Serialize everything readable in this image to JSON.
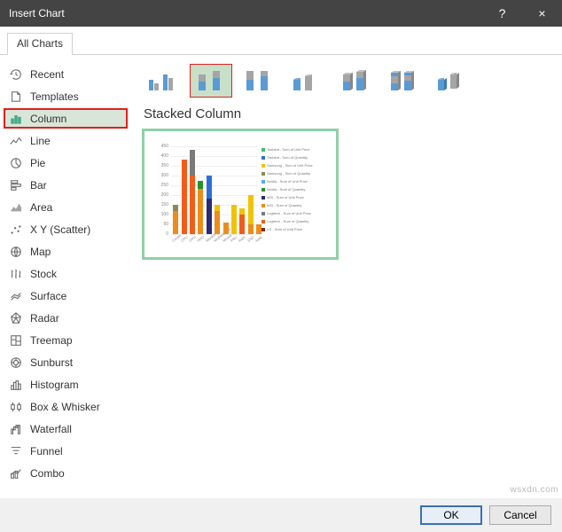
{
  "window": {
    "title": "Insert Chart",
    "help_label": "?",
    "close_label": "×"
  },
  "tabs": {
    "all_charts": "All Charts"
  },
  "sidebar": {
    "items": [
      {
        "label": "Recent"
      },
      {
        "label": "Templates"
      },
      {
        "label": "Column"
      },
      {
        "label": "Line"
      },
      {
        "label": "Pie"
      },
      {
        "label": "Bar"
      },
      {
        "label": "Area"
      },
      {
        "label": "X Y (Scatter)"
      },
      {
        "label": "Map"
      },
      {
        "label": "Stock"
      },
      {
        "label": "Surface"
      },
      {
        "label": "Radar"
      },
      {
        "label": "Treemap"
      },
      {
        "label": "Sunburst"
      },
      {
        "label": "Histogram"
      },
      {
        "label": "Box & Whisker"
      },
      {
        "label": "Waterfall"
      },
      {
        "label": "Funnel"
      },
      {
        "label": "Combo"
      }
    ],
    "selected_index": 2
  },
  "subtype": {
    "selected_index": 1,
    "title": "Stacked Column",
    "names": [
      "Clustered Column",
      "Stacked Column",
      "100% Stacked Column",
      "3-D Clustered Column",
      "3-D Stacked Column",
      "3-D 100% Stacked Column",
      "3-D Column"
    ]
  },
  "chart_data": {
    "type": "bar",
    "stacked": true,
    "ylim": [
      0,
      480
    ],
    "yticks": [
      0,
      50,
      100,
      150,
      200,
      250,
      300,
      350,
      400,
      450
    ],
    "categories": [
      "Cooler",
      "CPU",
      "GPU",
      "HDD",
      "Monitor",
      "Motherboard",
      "Mouse",
      "PSU",
      "Ram",
      "SSD",
      "Note"
    ],
    "series": [
      {
        "name": "Toshiba - Sum of Unit Price",
        "color": "#3bbf6b"
      },
      {
        "name": "Toshiba - Sum of Quantity",
        "color": "#2f6fd4"
      },
      {
        "name": "Samsung - Sum of Unit Price",
        "color": "#f0c300"
      },
      {
        "name": "Samsung - Sum of Quantity",
        "color": "#8a8a55"
      },
      {
        "name": "Nvidia - Sum of Unit Price",
        "color": "#5aa6ff"
      },
      {
        "name": "Nvidia - Sum of Quantity",
        "color": "#2a8f2a"
      },
      {
        "name": "MSI - Sum of Unit Price",
        "color": "#2a2a78"
      },
      {
        "name": "MSI - Sum of Quantity",
        "color": "#ec8c1a"
      },
      {
        "name": "Logitech - Sum of Unit Price",
        "color": "#7a7a7a"
      },
      {
        "name": "Logitech - Sum of Quantity",
        "color": "#f25c19"
      },
      {
        "name": "LG - Sum of Unit Price",
        "color": "#7a2d18"
      }
    ],
    "stacks": [
      [
        {
          "series": 7,
          "value": 120
        },
        {
          "series": 3,
          "value": 30
        }
      ],
      [
        {
          "series": 9,
          "value": 380
        }
      ],
      [
        {
          "series": 9,
          "value": 300
        },
        {
          "series": 8,
          "value": 130
        }
      ],
      [
        {
          "series": 7,
          "value": 230
        },
        {
          "series": 5,
          "value": 40
        }
      ],
      [
        {
          "series": 6,
          "value": 180
        },
        {
          "series": 1,
          "value": 120
        }
      ],
      [
        {
          "series": 7,
          "value": 120
        },
        {
          "series": 2,
          "value": 30
        }
      ],
      [
        {
          "series": 7,
          "value": 60
        }
      ],
      [
        {
          "series": 2,
          "value": 150
        }
      ],
      [
        {
          "series": 9,
          "value": 100
        },
        {
          "series": 2,
          "value": 30
        }
      ],
      [
        {
          "series": 7,
          "value": 50
        },
        {
          "series": 2,
          "value": 150
        }
      ],
      [
        {
          "series": 7,
          "value": 50
        }
      ]
    ]
  },
  "footer": {
    "ok": "OK",
    "cancel": "Cancel"
  },
  "watermark": "wsxdn.com"
}
